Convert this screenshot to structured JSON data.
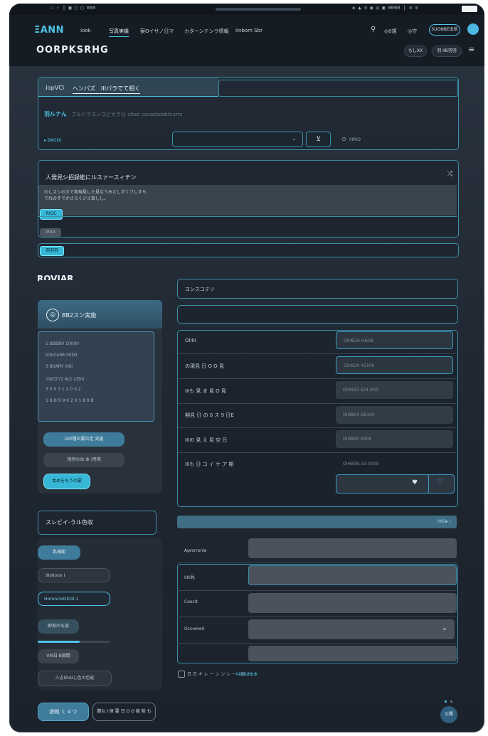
{
  "status_bar": {
    "left": "☐ ‹ | ▣ ▢ ▢  ≡≡≡",
    "right": "◈ ▲ ⊙  ◉ ◎  ▣  0000  | ⊙ ⊙"
  },
  "nav": {
    "brand": "ΞANN",
    "items": [
      "Iook",
      "写真実績",
      "案Oイサノ日マ",
      "カターンテンラ情報",
      "Iinbom Sbr"
    ],
    "right_items": [
      "◎0規",
      "◎守"
    ],
    "account_label": "SUGNBE出前",
    "title": "OORPKSRHG",
    "right_buttons": [
      "もしXX",
      "羽 IIB羽羽"
    ]
  },
  "search_panel": {
    "tab_left": ".lopVCI",
    "tab_active": "へンパズ　IIIパラでて相く",
    "desc_label": "羽ルナん",
    "desc_text": "プルドラヨンゴピカラ日 cibor cocasboaktcurrs",
    "link": "▸ BAGDI",
    "go_label": "⊻",
    "info_label": "IIIRIO"
  },
  "notice_panel": {
    "title": "人発見シ招録能にルスァースィテン",
    "body": "のしスシの大で実現見した見なうみとしずくフしすら\nでれのすでかさらくジさ差しし。",
    "chip1": "RIOC",
    "chip2": "IIIIUI",
    "chip3": "羽羽羽"
  },
  "left_col": {
    "section_title": "ROVIAR",
    "card_title": "BB2スン実施",
    "list": [
      "1 BBBB0 10000",
      "InfoCo9B 0IIDII",
      "3 B0ARY 0IIII",
      "190ひ72 ACI 1日III",
      "3 0 0 3 1 2 0 0 2",
      "1 B B 9 9 0 2 0 1 8 8 B"
    ],
    "btn1": "Dの種の要の定 実施",
    "btn2": "現然のIB 本 I用期",
    "btn3": "本めをもうの要",
    "section2": "スレビイ-うル色収",
    "s2_btn1": "乳様期",
    "s2_input1": "IIIoIIooo I",
    "s2_input2": "HoroncIoOI03I-1",
    "s2_btn2": "即扮のも族",
    "s2_btn3": "VIII日 B期間",
    "s2_btn4": "入吉IIIIAIし色の色能"
  },
  "right_col": {
    "field1_label": "ヨンスコテソ",
    "rows": [
      {
        "label": "OIIIII",
        "value": "OIHB29 G6O8"
      },
      {
        "label": "の現見 日 O O 見",
        "value": "OIH920 43100"
      },
      {
        "label": "IIIも 見 ま 見 O 見",
        "value": "OIH920 424 D00"
      },
      {
        "label": "期見 日 の 0 ス 9 日E",
        "value": "OIHB04 O6100"
      },
      {
        "label": "IIIの 見 え 見 空 日",
        "value": "OIHB00 0006"
      },
      {
        "label": "IIIも 日 コ イ ケ ア 期",
        "value": "OIHB0B-10-0009"
      }
    ],
    "row_icon_left": "♥",
    "row_icon_right": "♡",
    "bar_label": "IIIIO▸ ›",
    "form_rows": [
      "Aprorronle",
      "IIIII見",
      "Coocit",
      "Occomerl",
      ""
    ],
    "checkbox_label": "日 日 キ レ ー ン ン レ ー - ロ ノ",
    "checkbox_link": "IIIIBIIII本本"
  },
  "footer": {
    "btn1": "遊戦 く 4 ウ",
    "btn2": "題な I 原 要 日 O O 能 能 も",
    "fab": "公開"
  },
  "colors": {
    "accent": "#4fc3e6",
    "panel_border": "#3d8fa8",
    "chip_cyan": "#36b7d6"
  }
}
